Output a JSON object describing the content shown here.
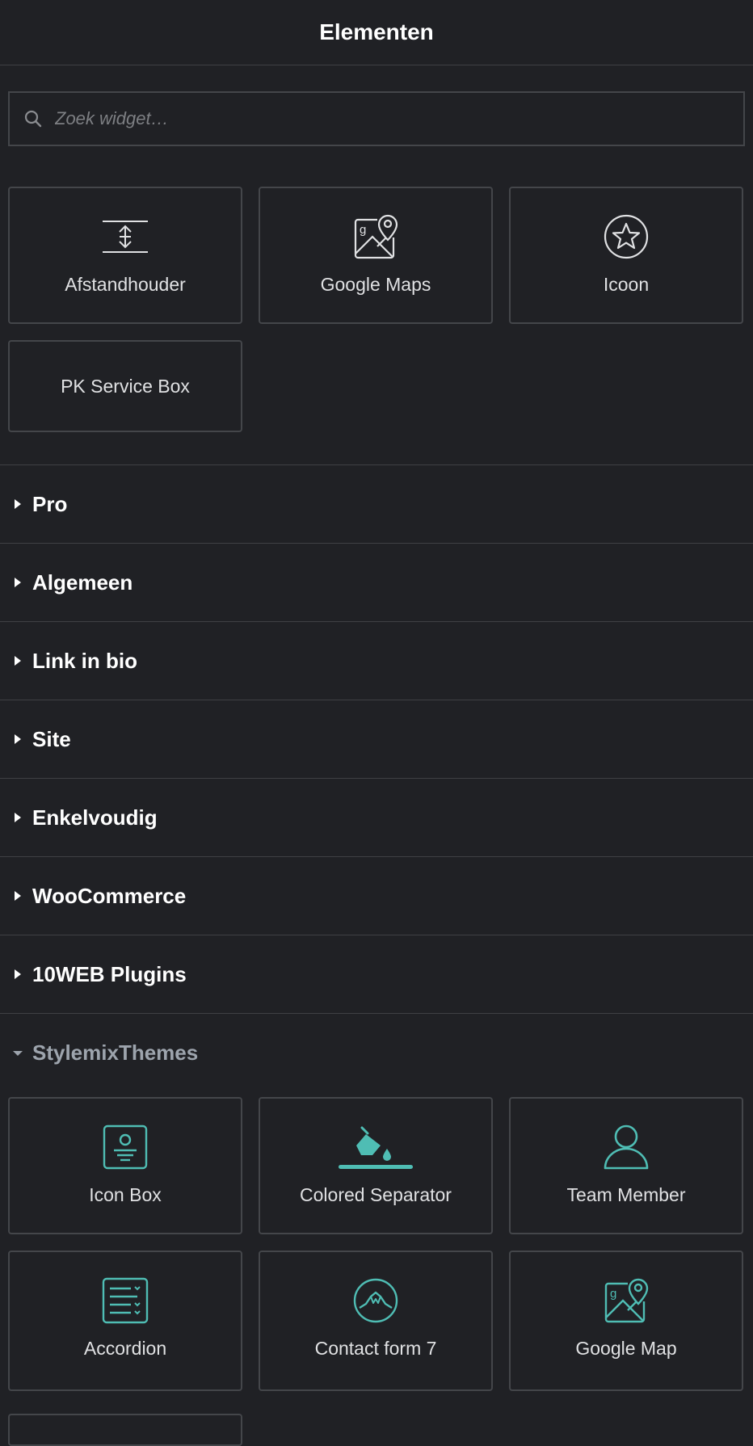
{
  "header": {
    "title": "Elementen"
  },
  "search": {
    "placeholder": "Zoek widget…",
    "icon": "search-icon"
  },
  "favorites": [
    {
      "label": "Afstandhouder",
      "icon": "spacer-icon"
    },
    {
      "label": "Google Maps",
      "icon": "google-maps-icon"
    },
    {
      "label": "Icoon",
      "icon": "star-icon"
    },
    {
      "label": "PK Service Box",
      "icon": ""
    }
  ],
  "categories": [
    {
      "label": "Pro",
      "state": "collapsed"
    },
    {
      "label": "Algemeen",
      "state": "collapsed"
    },
    {
      "label": "Link in bio",
      "state": "collapsed"
    },
    {
      "label": "Site",
      "state": "collapsed"
    },
    {
      "label": "Enkelvoudig",
      "state": "collapsed"
    },
    {
      "label": "WooCommerce",
      "state": "collapsed"
    },
    {
      "label": "10WEB Plugins",
      "state": "collapsed"
    },
    {
      "label": "StylemixThemes",
      "state": "expanded"
    }
  ],
  "stylemix": [
    {
      "label": "Icon Box",
      "icon": "icon-box-icon"
    },
    {
      "label": "Colored Separator",
      "icon": "paint-bucket-icon"
    },
    {
      "label": "Team Member",
      "icon": "person-icon"
    },
    {
      "label": "Accordion",
      "icon": "accordion-icon"
    },
    {
      "label": "Contact form 7",
      "icon": "mountain-circle-icon"
    },
    {
      "label": "Google Map",
      "icon": "google-map-icon"
    }
  ],
  "colors": {
    "background": "#202125",
    "border": "#44464a",
    "accent": "#4fbdb4",
    "text": "#e0e1e3",
    "muted": "#9da4ad"
  }
}
